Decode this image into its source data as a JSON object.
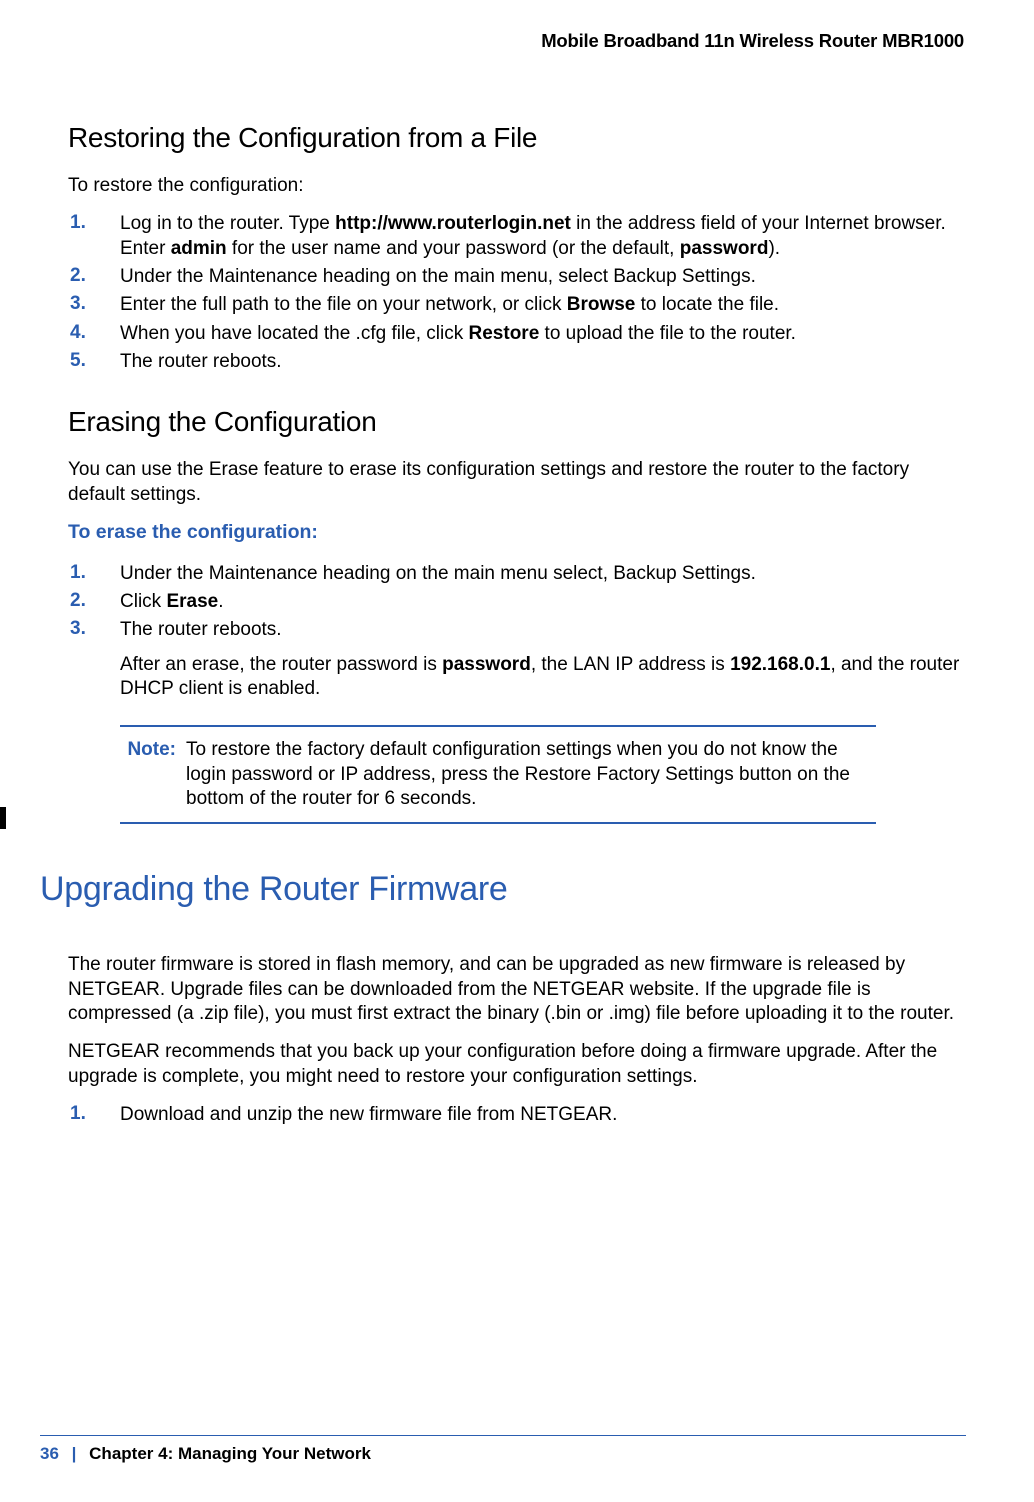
{
  "header": {
    "product": "Mobile Broadband 11n Wireless Router MBR1000"
  },
  "section1": {
    "title": "Restoring the Configuration from a File",
    "intro": "To restore the configuration:",
    "steps": {
      "s1": {
        "num": "1.",
        "pre": "Log in to the router. Type ",
        "url": "http://www.routerlogin.net",
        "mid1": " in the address field of your Internet browser. Enter ",
        "admin": "admin",
        "mid2": " for the user name and your password (or the default, ",
        "pwd": "password",
        "post": ")."
      },
      "s2": {
        "num": "2.",
        "text": "Under the Maintenance heading on the main menu, select Backup Settings."
      },
      "s3": {
        "num": "3.",
        "pre": "Enter the full path to the file on your network, or click ",
        "bold": "Browse",
        "post": " to locate the file."
      },
      "s4": {
        "num": "4.",
        "pre": "When you have located the .cfg file, click ",
        "bold": "Restore",
        "post": " to upload the file to the router."
      },
      "s5": {
        "num": "5.",
        "text": "The router reboots."
      }
    }
  },
  "section2": {
    "title": "Erasing the Configuration",
    "intro": "You can use the Erase feature to erase its configuration settings and restore the router to the factory default settings.",
    "subhead": "To erase the configuration:",
    "steps": {
      "s1": {
        "num": "1.",
        "text": "Under the Maintenance heading on the main menu select, Backup Settings."
      },
      "s2": {
        "num": "2.",
        "pre": "Click ",
        "bold": "Erase",
        "post": "."
      },
      "s3": {
        "num": "3.",
        "text": "The router reboots."
      }
    },
    "postErase": {
      "pre": "After an erase, the router password is ",
      "pwd": "password",
      "mid": ", the LAN IP address is ",
      "ip": "192.168.0.1",
      "post": ", and the router DHCP client is enabled."
    },
    "note": {
      "label": "Note:",
      "text": "To restore the factory default configuration settings when you do not know the login password or IP address, press the Restore Factory Settings button on the bottom of the router for 6 seconds."
    }
  },
  "section3": {
    "title": "Upgrading the Router Firmware",
    "p1": "The router firmware is stored in flash memory, and can be upgraded as new firmware is released by NETGEAR. Upgrade files can be downloaded from the NETGEAR website. If the upgrade file is compressed (a .zip file), you must first extract the binary (.bin or .img) file before uploading it to the router.",
    "p2": "NETGEAR recommends that you back up your configuration before doing a firmware upgrade. After the upgrade is complete, you might need to restore your configuration settings.",
    "steps": {
      "s1": {
        "num": "1.",
        "text": "Download and unzip the new firmware file from NETGEAR."
      }
    }
  },
  "footer": {
    "pageNum": "36",
    "sep": "|",
    "chapter": "Chapter 4:",
    "title": "Managing Your Network"
  }
}
